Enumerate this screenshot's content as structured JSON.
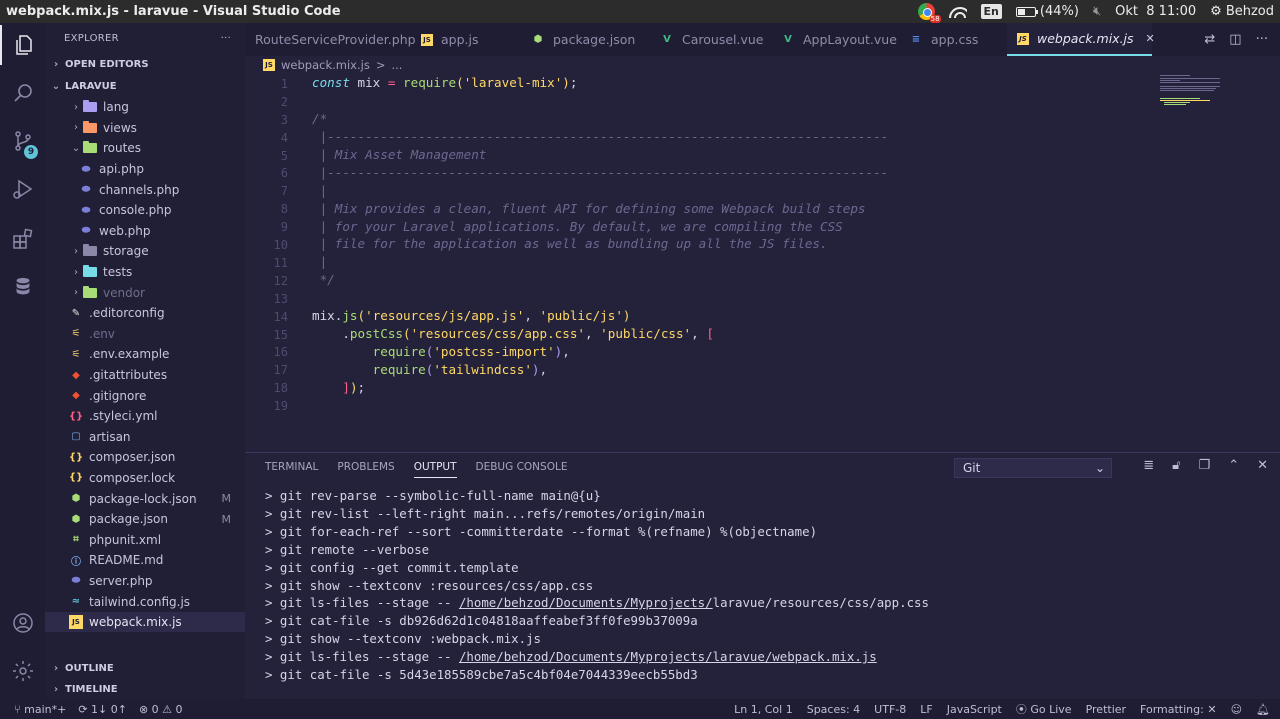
{
  "window": {
    "title": "webpack.mix.js - laravue - Visual Studio Code"
  },
  "system_tray": {
    "chrome_badge": "58",
    "keyboard_layout": "En",
    "battery": "(44%)",
    "battery_level": 0.44,
    "datetime": "Okt  8 11:00",
    "user": "Behzod"
  },
  "activity_bar": {
    "source_control_badge": "9"
  },
  "sidebar": {
    "title": "EXPLORER",
    "more": "···",
    "open_editors": "OPEN EDITORS",
    "project": "LARAVUE",
    "tree": [
      {
        "label": "lang",
        "type": "folder",
        "indent": 1,
        "color": "#ab9df2",
        "expanded": false
      },
      {
        "label": "views",
        "type": "folder",
        "indent": 1,
        "color": "#fc9867",
        "expanded": false
      },
      {
        "label": "routes",
        "type": "folder",
        "indent": 1,
        "color": "#a9dc76",
        "expanded": true
      },
      {
        "label": "api.php",
        "type": "php",
        "indent": 2
      },
      {
        "label": "channels.php",
        "type": "php",
        "indent": 2
      },
      {
        "label": "console.php",
        "type": "php",
        "indent": 2
      },
      {
        "label": "web.php",
        "type": "php",
        "indent": 2
      },
      {
        "label": "storage",
        "type": "folder",
        "indent": 1,
        "color": "#8a87a8",
        "expanded": false
      },
      {
        "label": "tests",
        "type": "folder",
        "indent": 1,
        "color": "#78dce8",
        "expanded": false
      },
      {
        "label": "vendor",
        "type": "folder",
        "indent": 1,
        "color": "#a9dc76",
        "expanded": false,
        "dim": true
      },
      {
        "label": ".editorconfig",
        "type": "config",
        "indent": 1
      },
      {
        "label": ".env",
        "type": "env",
        "indent": 1,
        "dim": true
      },
      {
        "label": ".env.example",
        "type": "env",
        "indent": 1
      },
      {
        "label": ".gitattributes",
        "type": "git",
        "indent": 1
      },
      {
        "label": ".gitignore",
        "type": "git",
        "indent": 1
      },
      {
        "label": ".styleci.yml",
        "type": "yml",
        "indent": 1
      },
      {
        "label": "artisan",
        "type": "file",
        "indent": 1
      },
      {
        "label": "composer.json",
        "type": "json",
        "indent": 1
      },
      {
        "label": "composer.lock",
        "type": "json",
        "indent": 1
      },
      {
        "label": "package-lock.json",
        "type": "npm",
        "indent": 1,
        "mod": "M"
      },
      {
        "label": "package.json",
        "type": "npm",
        "indent": 1,
        "mod": "M"
      },
      {
        "label": "phpunit.xml",
        "type": "xml",
        "indent": 1
      },
      {
        "label": "README.md",
        "type": "info",
        "indent": 1
      },
      {
        "label": "server.php",
        "type": "php",
        "indent": 1
      },
      {
        "label": "tailwind.config.js",
        "type": "tailwind",
        "indent": 1
      },
      {
        "label": "webpack.mix.js",
        "type": "js",
        "indent": 1,
        "selected": true
      }
    ],
    "outline": "OUTLINE",
    "timeline": "TIMELINE"
  },
  "tabs": [
    {
      "label": "RouteServiceProvider.php",
      "type": "none"
    },
    {
      "label": "app.js",
      "type": "js"
    },
    {
      "label": "package.json",
      "type": "npm"
    },
    {
      "label": "Carousel.vue",
      "type": "vue"
    },
    {
      "label": "AppLayout.vue",
      "type": "vue"
    },
    {
      "label": "app.css",
      "type": "css"
    },
    {
      "label": "webpack.mix.js",
      "type": "js",
      "active": true,
      "close": "✕"
    }
  ],
  "breadcrumb": {
    "file": "webpack.mix.js",
    "sep": ">",
    "rest": "..."
  },
  "editor": {
    "line_numbers": [
      "1",
      "2",
      "3",
      "4",
      "5",
      "6",
      "7",
      "8",
      "9",
      "10",
      "11",
      "12",
      "13",
      "14",
      "15",
      "16",
      "17",
      "18",
      "19"
    ]
  },
  "panel": {
    "tabs": [
      "TERMINAL",
      "PROBLEMS",
      "OUTPUT",
      "DEBUG CONSOLE"
    ],
    "active_tab": "OUTPUT",
    "channel": "Git",
    "output_lines": [
      {
        "text": "> git rev-parse --symbolic-full-name main@{u}"
      },
      {
        "text": "> git rev-list --left-right main...refs/remotes/origin/main"
      },
      {
        "text": "> git for-each-ref --sort -committerdate --format %(refname) %(objectname)"
      },
      {
        "text": "> git remote --verbose"
      },
      {
        "text": "> git config --get commit.template"
      },
      {
        "text": "> git show --textconv :resources/css/app.css"
      },
      {
        "pre": "> git ls-files --stage -- ",
        "link": "/home/behzod/Documents/Myprojects/",
        "post": "laravue/resources/css/app.css"
      },
      {
        "text": "> git cat-file -s db926d62d1c04818aaffeabef3ff0fe99b37009a"
      },
      {
        "text": "> git show --textconv :webpack.mix.js"
      },
      {
        "pre": "> git ls-files --stage -- ",
        "link": "/home/behzod/Documents/Myprojects/laravue/webpack.mix.js",
        "post": ""
      },
      {
        "text": "> git cat-file -s 5d43e185589cbe7a5c4bf04e7044339eecb55bd3"
      }
    ]
  },
  "status_bar": {
    "branch": "main*+",
    "sync": "1↓ 0↑",
    "problems": "⊗ 0 ⚠ 0",
    "position": "Ln 1, Col 1",
    "spaces": "Spaces: 4",
    "encoding": "UTF-8",
    "eol": "LF",
    "language": "JavaScript",
    "golive": "Go Live",
    "prettier": "Prettier",
    "formatting": "Formatting: ✕"
  }
}
